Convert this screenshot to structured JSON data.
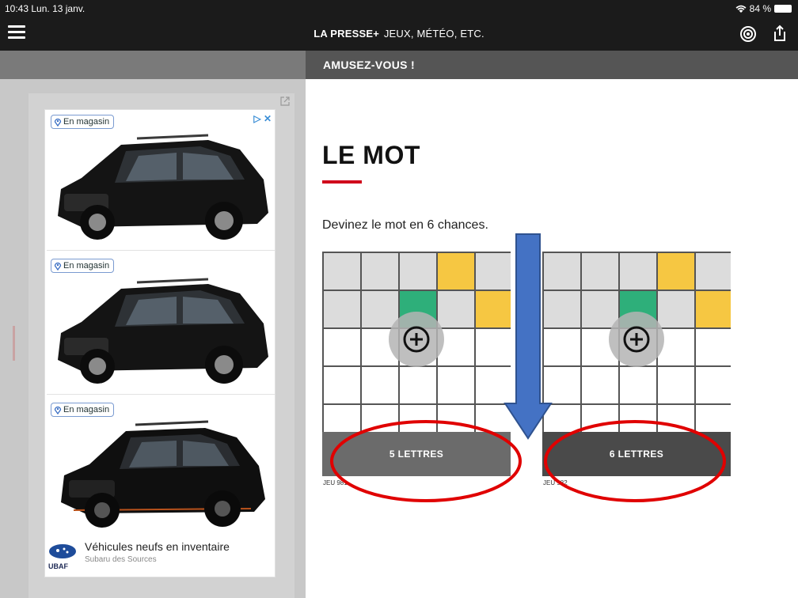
{
  "status_bar": {
    "time": "10:43",
    "date": "Lun. 13 janv.",
    "battery": "84 %"
  },
  "app_bar": {
    "brand": "LA PRESSE+",
    "section": "JEUX, MÉTÉO, ETC."
  },
  "section_header": "AMUSEZ-VOUS !",
  "ad": {
    "badge_label": "En magasin",
    "headline": "Véhicules neufs en inventaire",
    "advertiser": "Subaru des Sources",
    "logo_text": "UBAF",
    "colors": {
      "badge_border": "#7a9bd1",
      "adchoice": "#3b8ed6"
    }
  },
  "game": {
    "title": "LE MOT",
    "description": "Devinez le mot en 6 chances.",
    "accent_color": "#d0021b",
    "cards": [
      {
        "button_label": "5 LETTRES",
        "id_label": "JEU 981",
        "rows": [
          [
            "gray",
            "gray",
            "gray",
            "yellow",
            "gray"
          ],
          [
            "gray",
            "gray",
            "green",
            "gray",
            "yellow"
          ],
          [
            "white",
            "white",
            "white",
            "white",
            "white"
          ],
          [
            "white",
            "white",
            "white",
            "white",
            "white"
          ],
          [
            "white",
            "white",
            "white",
            "white",
            "white"
          ]
        ]
      },
      {
        "button_label": "6 LETTRES",
        "id_label": "JEU 982",
        "rows": [
          [
            "gray",
            "gray",
            "gray",
            "yellow",
            "gray",
            "gray"
          ],
          [
            "gray",
            "gray",
            "green",
            "gray",
            "yellow",
            "gray"
          ],
          [
            "white",
            "white",
            "white",
            "white",
            "white",
            "white"
          ],
          [
            "white",
            "white",
            "white",
            "white",
            "white",
            "white"
          ],
          [
            "white",
            "white",
            "white",
            "white",
            "white",
            "white"
          ]
        ]
      }
    ],
    "tile_colors": {
      "gray": "#dcdcdc",
      "yellow": "#f6c742",
      "green": "#2eaf7a",
      "white": "#ffffff"
    }
  },
  "annotations": {
    "arrow_color": "#4472c4",
    "ellipse_color": "#e00000"
  }
}
